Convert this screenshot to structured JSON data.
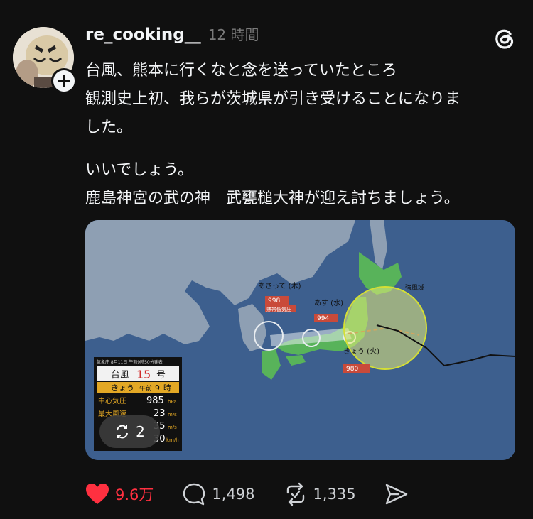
{
  "post": {
    "username": "re_cooking__",
    "time": "12 時間",
    "lines": [
      "台風、熊本に行くなと念を送っていたところ",
      "観測史上初、我らが茨城県が引き受けることになりま",
      "した。",
      "いいでしょう。",
      "鹿島神宮の武の神　武甕槌大神が迎え討ちましょう。"
    ]
  },
  "media": {
    "image_count": "2",
    "map": {
      "strong_wind_label": "強風域",
      "days": [
        {
          "day": "あさって (木)",
          "time": "午前 9 時",
          "pressure": "998",
          "unit": "hPa",
          "note": "熱帯低気圧"
        },
        {
          "day": "あす (水)",
          "time": "午前 9 時",
          "pressure": "994",
          "unit": "hPa"
        },
        {
          "day": "きょう (火)",
          "time": "午後 9 時",
          "pressure": "980",
          "unit": "hPa"
        }
      ]
    },
    "info": {
      "announced": "気象庁 8月11日 午前9時50分発表",
      "title_prefix": "台風",
      "number": "15",
      "title_suffix": "号",
      "time_label": "きょう",
      "time_sub": "午前",
      "time_hour": "9",
      "time_suffix": "時",
      "rows": [
        {
          "label": "中心気圧",
          "value": "985",
          "unit": "hPa"
        },
        {
          "label": "最大風速",
          "value": "23",
          "unit": "m/s"
        },
        {
          "label": "",
          "value": "35",
          "unit": "m/s"
        },
        {
          "label": "",
          "value": "30",
          "unit": "km/h"
        }
      ]
    }
  },
  "actions": {
    "likes": "9.6万",
    "replies": "1,498",
    "reposts": "1,335"
  },
  "colors": {
    "like": "#ff3040",
    "background": "#101010"
  }
}
